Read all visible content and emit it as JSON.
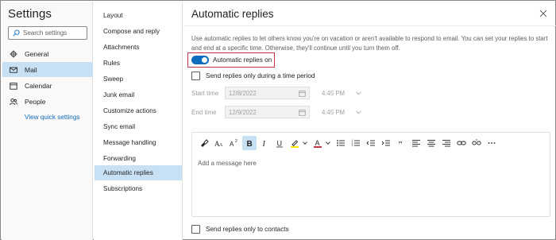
{
  "left": {
    "title": "Settings",
    "search_placeholder": "Search settings",
    "nav": [
      {
        "label": "General",
        "icon": "gear-icon"
      },
      {
        "label": "Mail",
        "icon": "mail-icon"
      },
      {
        "label": "Calendar",
        "icon": "calendar-icon"
      },
      {
        "label": "People",
        "icon": "people-icon"
      }
    ],
    "view_link": "View quick settings"
  },
  "middle": {
    "items": [
      "Layout",
      "Compose and reply",
      "Attachments",
      "Rules",
      "Sweep",
      "Junk email",
      "Customize actions",
      "Sync email",
      "Message handling",
      "Forwarding",
      "Automatic replies",
      "Subscriptions"
    ],
    "active": "Automatic replies"
  },
  "right": {
    "title": "Automatic replies",
    "description": "Use automatic replies to let others know you're on vacation or aren't available to respond to email. You can set your replies to start and end at a specific time. Otherwise, they'll continue until you turn them off.",
    "toggle_label": "Automatic replies on",
    "time_period_label": "Send replies only during a time period",
    "start_label": "Start time",
    "start_date": "12/8/2022",
    "start_time": "4:45 PM",
    "end_label": "End time",
    "end_date": "12/9/2022",
    "end_time": "4:45 PM",
    "editor_placeholder": "Add a message here",
    "contacts_label": "Send replies only to contacts"
  },
  "colors": {
    "accent": "#0f6cbd",
    "selected_bg": "#c7e0f4",
    "highlight_border": "#c4314b"
  }
}
